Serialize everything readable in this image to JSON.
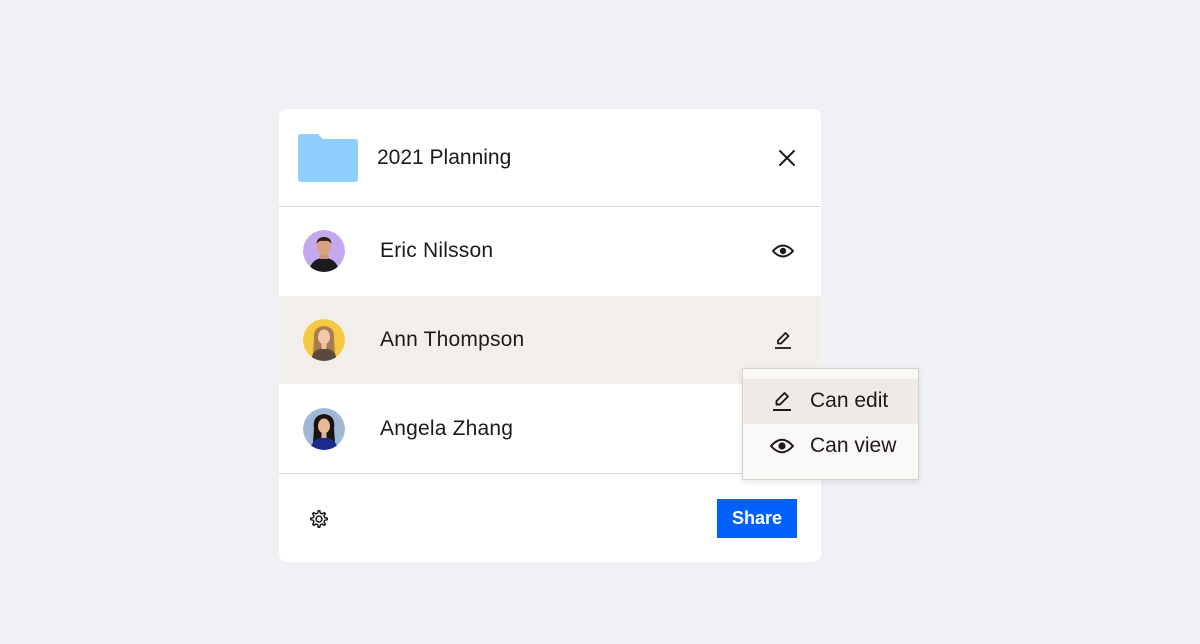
{
  "dialog": {
    "folder_name": "2021 Planning",
    "folder_icon": "folder-icon",
    "close_icon": "close-icon",
    "folder_color": "#90ceff"
  },
  "members": [
    {
      "name": "Eric Nilsson",
      "permission_icon": "eye-icon",
      "avatar_bg": "#c4a8f0"
    },
    {
      "name": "Ann Thompson",
      "permission_icon": "pencil-icon",
      "avatar_bg": "#f5c842",
      "selected": true
    },
    {
      "name": "Angela Zhang",
      "permission_icon": "none",
      "avatar_bg": "#9fb8d6"
    }
  ],
  "footer": {
    "settings_icon": "gear-icon",
    "share_label": "Share",
    "share_color": "#0061fe"
  },
  "permission_menu": {
    "items": [
      {
        "label": "Can edit",
        "icon": "pencil-icon",
        "active": true
      },
      {
        "label": "Can view",
        "icon": "eye-icon",
        "active": false
      }
    ]
  }
}
